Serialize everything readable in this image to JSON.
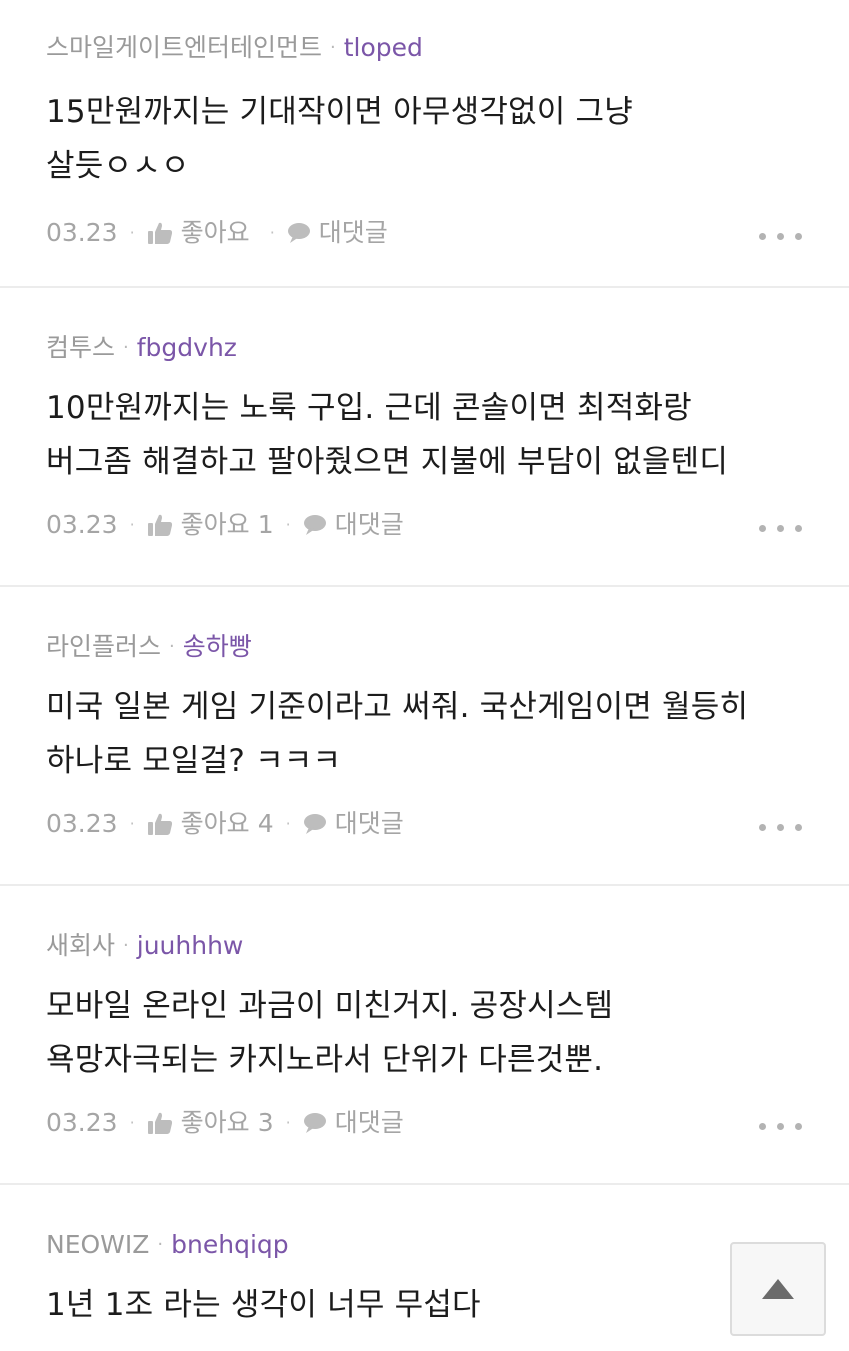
{
  "comments": [
    {
      "company": "스마일게이트엔터테인먼트",
      "separator": "·",
      "user": "tloped",
      "lines": [
        "15만원까지는 기대작이면 아무생각없이 그냥",
        "살듯ㅇㅅㅇ"
      ],
      "date": "03.23",
      "like_label": "좋아요",
      "like_count": "",
      "reply_label": "대댓글"
    },
    {
      "company": "컴투스",
      "separator": "·",
      "user": "fbgdvhz",
      "lines": [
        "10만원까지는 노룩 구입. 근데 콘솔이면 최적화랑",
        "버그좀 해결하고 팔아줬으면 지불에 부담이 없을텐디"
      ],
      "date": "03.23",
      "like_label": "좋아요",
      "like_count": "1",
      "reply_label": "대댓글"
    },
    {
      "company": "라인플러스",
      "separator": "·",
      "user": "송하빵",
      "lines": [
        "미국 일본 게임 기준이라고 써줘. 국산게임이면 월등히",
        "하나로 모일걸? ㅋㅋㅋ"
      ],
      "date": "03.23",
      "like_label": "좋아요",
      "like_count": "4",
      "reply_label": "대댓글"
    },
    {
      "company": "새회사",
      "separator": "·",
      "user": "juuhhhw",
      "lines": [
        "모바일 온라인 과금이 미친거지. 공장시스템",
        "욕망자극되는 카지노라서 단위가 다른것뿐."
      ],
      "date": "03.23",
      "like_label": "좋아요",
      "like_count": "3",
      "reply_label": "대댓글"
    },
    {
      "company": "NEOWIZ",
      "separator": "·",
      "user": "bnehqiqp",
      "lines": [
        "1년 1조 라는 생각이 너무 무섭다"
      ]
    }
  ],
  "footer_dot": "·",
  "icons": {
    "like": "thumbs-up-icon",
    "reply": "speech-bubble-icon",
    "more": "more-dots-icon",
    "scroll_top": "triangle-up-icon"
  },
  "colors": {
    "username": "#7b56a8",
    "meta": "#9a9a9a",
    "icon": "#bdbdbd",
    "divider": "#ececec"
  }
}
